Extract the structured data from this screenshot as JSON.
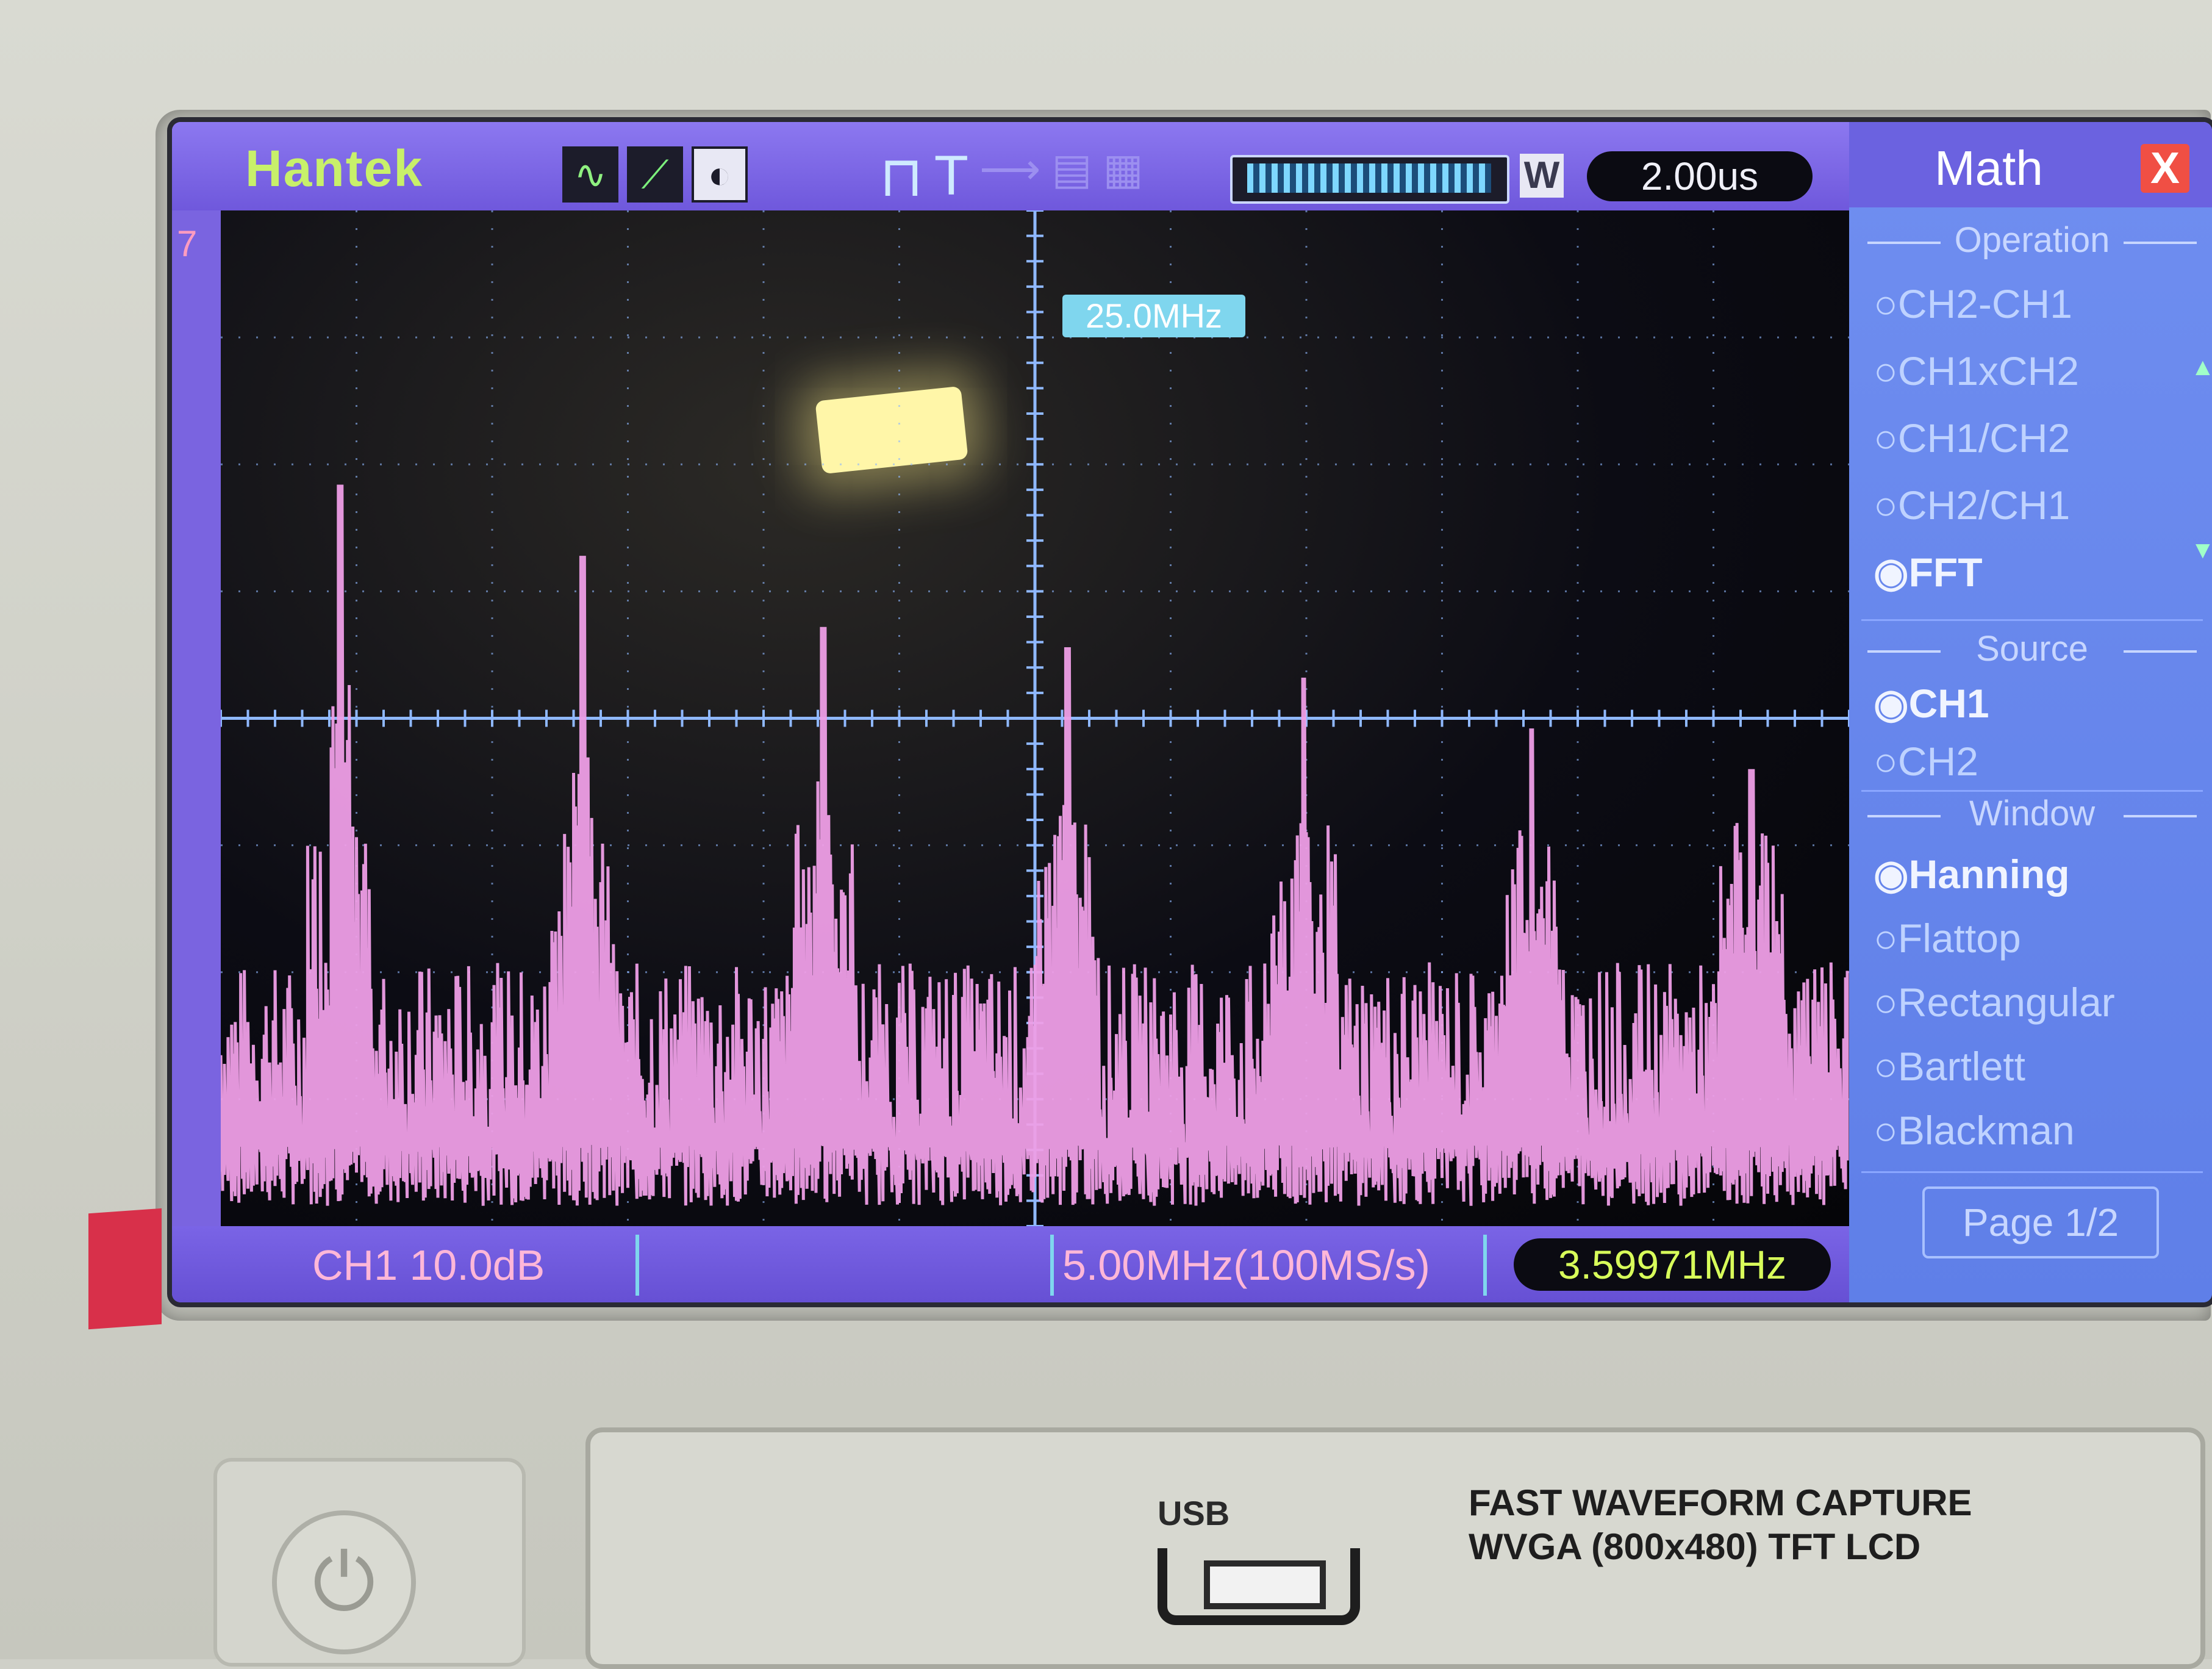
{
  "header": {
    "brand": "Hantek",
    "timebase": "2.00us",
    "mode_badge": "W",
    "trigger_icon": "pulse-icon",
    "trigger_label": "T"
  },
  "plot": {
    "marker_freq": "25.0MHz",
    "edge_mark": "7"
  },
  "status": {
    "channel_scale": "CH1 10.0dB",
    "span": "5.00MHz(100MS/s)",
    "measured_freq": "3.59971MHz"
  },
  "menu": {
    "title": "Math",
    "close": "X",
    "operation_heading": "Operation",
    "operations": [
      {
        "label": "CH2-CH1",
        "selected": false
      },
      {
        "label": "CH1xCH2",
        "selected": false
      },
      {
        "label": "CH1/CH2",
        "selected": false
      },
      {
        "label": "CH2/CH1",
        "selected": false
      },
      {
        "label": "FFT",
        "selected": true
      }
    ],
    "source_heading": "Source",
    "sources": [
      {
        "label": "CH1",
        "selected": true
      },
      {
        "label": "CH2",
        "selected": false
      }
    ],
    "window_heading": "Window",
    "windows": [
      {
        "label": "Hanning",
        "selected": true
      },
      {
        "label": "Flattop",
        "selected": false
      },
      {
        "label": "Rectangular",
        "selected": false
      },
      {
        "label": "Bartlett",
        "selected": false
      },
      {
        "label": "Blackman",
        "selected": false
      }
    ],
    "page": "Page 1/2"
  },
  "panel": {
    "usb": "USB",
    "line1": "FAST WAVEFORM CAPTURE",
    "line2": "WVGA (800x480) TFT LCD"
  },
  "spectrum": {
    "trace_color": "#ee9ee6",
    "grid_color": "#8fb8ff",
    "peaks": [
      {
        "pos": 0.073,
        "level": 0.73
      },
      {
        "pos": 0.222,
        "level": 0.66
      },
      {
        "pos": 0.37,
        "level": 0.59
      },
      {
        "pos": 0.52,
        "level": 0.57
      },
      {
        "pos": 0.665,
        "level": 0.54
      },
      {
        "pos": 0.805,
        "level": 0.49
      },
      {
        "pos": 0.94,
        "level": 0.45
      }
    ],
    "noise_floor": 0.2
  }
}
